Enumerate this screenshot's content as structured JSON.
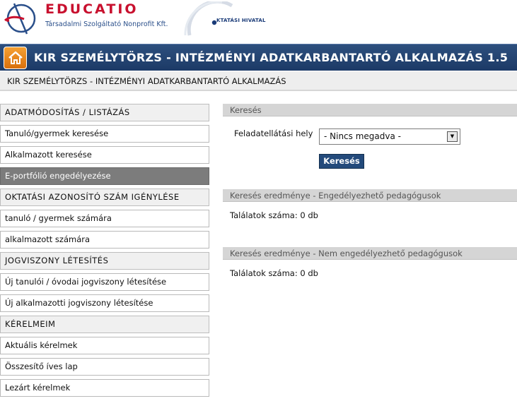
{
  "logos": {
    "educatio_name": "EDUCATIO",
    "educatio_subtitle": "Társadalmi Szolgáltató Nonprofit Kft.",
    "okt_name": "KTATÁSI HIVATAL"
  },
  "header": {
    "title": "KIR SZEMÉLYTÖRZS - INTÉZMÉNYI ADATKARBANTARTÓ ALKALMAZÁS 1.5",
    "breadcrumb": "KIR SZEMÉLYTÖRZS - INTÉZMÉNYI ADATKARBANTARTÓ ALKALMAZÁS"
  },
  "sidebar": {
    "items": [
      {
        "label": "ADATMÓDOSÍTÁS / LISTÁZÁS",
        "kind": "section"
      },
      {
        "label": "Tanuló/gyermek keresése",
        "kind": "link"
      },
      {
        "label": "Alkalmazott keresése",
        "kind": "link"
      },
      {
        "label": "E-portfólió engedélyezése",
        "kind": "active"
      },
      {
        "label": "OKTATÁSI AZONOSÍTÓ SZÁM IGÉNYLÉSE",
        "kind": "section"
      },
      {
        "label": "tanuló / gyermek számára",
        "kind": "link"
      },
      {
        "label": "alkalmazott számára",
        "kind": "link"
      },
      {
        "label": "JOGVISZONY LÉTESÍTÉS",
        "kind": "section"
      },
      {
        "label": "Új tanulói / óvodai jogviszony létesítése",
        "kind": "link"
      },
      {
        "label": "Új alkalmazotti jogviszony létesítése",
        "kind": "link"
      },
      {
        "label": "KÉRELMEIM",
        "kind": "section"
      },
      {
        "label": "Aktuális kérelmek",
        "kind": "link"
      },
      {
        "label": "Összesítő íves lap",
        "kind": "link"
      },
      {
        "label": "Lezárt kérelmek",
        "kind": "link"
      }
    ]
  },
  "search": {
    "heading": "Keresés",
    "field_label": "Feladatellátási hely",
    "select_value": "- Nincs megadva -",
    "button_label": "Keresés"
  },
  "results": {
    "approvable_heading": "Keresés eredménye - Engedélyezhető pedagógusok",
    "approvable_count": "Találatok száma: 0 db",
    "not_approvable_heading": "Keresés eredménye - Nem engedélyezhető pedagógusok",
    "not_approvable_count": "Találatok száma: 0 db"
  },
  "colors": {
    "title_bar": "#1c3a66",
    "home_button": "#e88a1e",
    "educatio_red": "#c8102e",
    "active_item": "#7c7c7c",
    "search_button": "#234a7b"
  },
  "icons": {
    "home": "house-icon",
    "select_arrow": "triangle-down"
  }
}
